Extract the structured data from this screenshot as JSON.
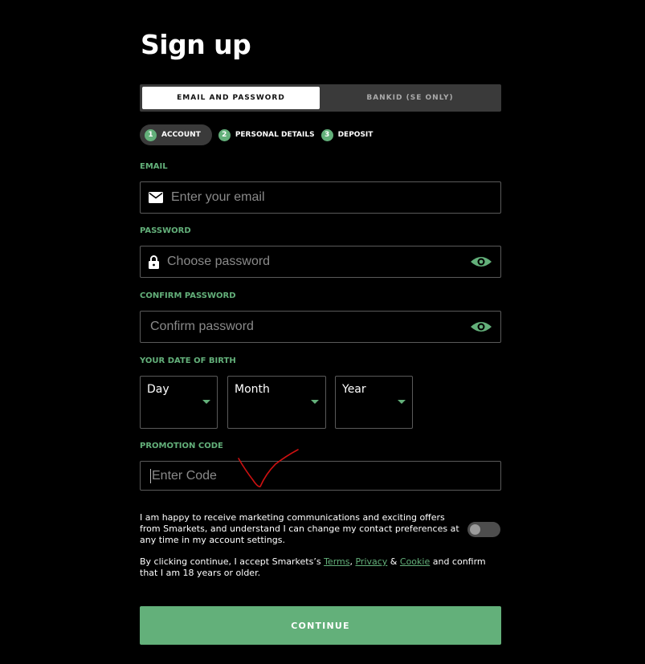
{
  "page": {
    "title": "Sign up"
  },
  "tabs": {
    "email_password": "EMAIL AND PASSWORD",
    "bankid": "BANKID (SE ONLY)"
  },
  "steps": [
    {
      "num": "1",
      "label": "ACCOUNT"
    },
    {
      "num": "2",
      "label": "PERSONAL DETAILS"
    },
    {
      "num": "3",
      "label": "DEPOSIT"
    }
  ],
  "form": {
    "email_label": "EMAIL",
    "email_placeholder": "Enter your email",
    "password_label": "PASSWORD",
    "password_placeholder": "Choose password",
    "confirm_label": "CONFIRM PASSWORD",
    "confirm_placeholder": "Confirm password",
    "dob_label": "YOUR DATE OF BIRTH",
    "day": "Day",
    "month": "Month",
    "year": "Year",
    "promo_label": "PROMOTION CODE",
    "promo_placeholder": "Enter Code"
  },
  "marketing": {
    "text": "I am happy to receive marketing communications and exciting offers from Smarkets, and understand I can change my contact preferences at any time in my account settings.",
    "toggle_on": false
  },
  "terms": {
    "prefix": "By clicking continue, I accept Smarkets’s ",
    "terms_link": "Terms",
    "comma": ", ",
    "privacy_link": "Privacy",
    "amp": " & ",
    "cookie_link": "Cookie",
    "suffix": " and confirm that I am 18 years or older."
  },
  "continue_label": "CONTINUE",
  "colors": {
    "accent": "#63b07a",
    "background": "#000000",
    "field_border": "#5a5a5a",
    "annotation": "#cc1111"
  },
  "icons": [
    "envelope-icon",
    "lock-icon",
    "eye-icon",
    "chevron-down-icon"
  ]
}
